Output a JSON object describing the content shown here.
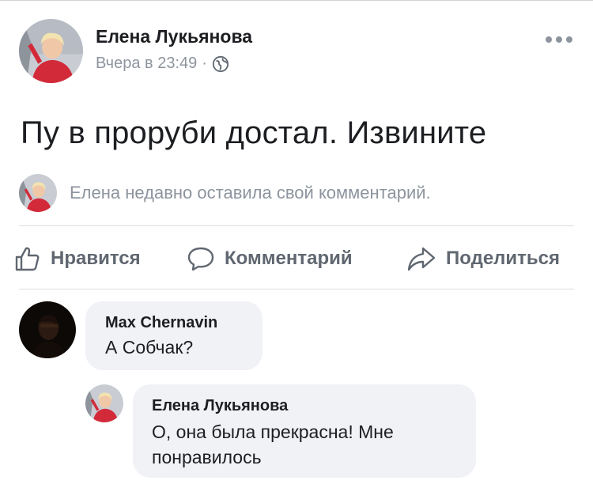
{
  "post": {
    "author": "Елена Лукьянова",
    "time": "Вчера в 23:49",
    "separator": "·",
    "privacy_icon": "globe-icon",
    "text": "Пу в проруби достал. Извините",
    "recent_activity": "Елена недавно оставила свой комментарий."
  },
  "actions": {
    "like": "Нравится",
    "comment": "Комментарий",
    "share": "Поделиться"
  },
  "comments": [
    {
      "author": "Max Chernavin",
      "text": "А Собчак?"
    },
    {
      "author": "Елена Лукьянова",
      "text_line1": "О, она была прекрасна! Мне",
      "text_line2": "понравилось"
    }
  ],
  "colors": {
    "text_primary": "#1c1e21",
    "text_secondary": "#8d949e",
    "action_gray": "#606770",
    "bubble_bg": "#f0f2f5",
    "avatar_accent": "#d32a3a"
  }
}
